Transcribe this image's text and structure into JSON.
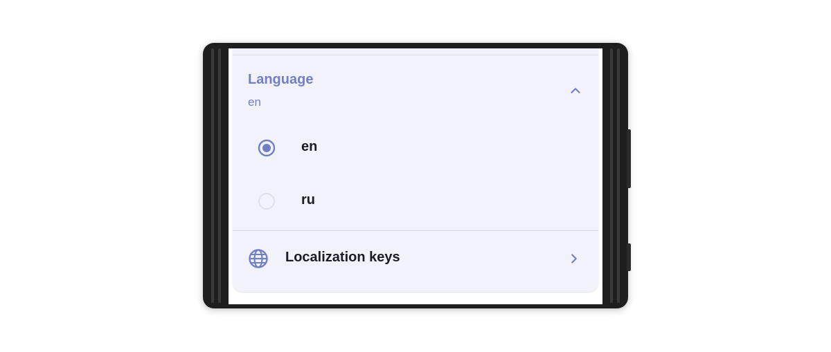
{
  "language_section": {
    "title": "Language",
    "selected_value": "en",
    "expanded": true,
    "options": [
      {
        "label": "en",
        "selected": true
      },
      {
        "label": "ru",
        "selected": false
      }
    ]
  },
  "localization_item": {
    "label": "Localization keys",
    "icon": "globe-icon"
  },
  "colors": {
    "accent": "#7180c2",
    "card_background": "#f1f2fa",
    "text": "#1c1c28",
    "device_frame": "#1e1e1e"
  }
}
